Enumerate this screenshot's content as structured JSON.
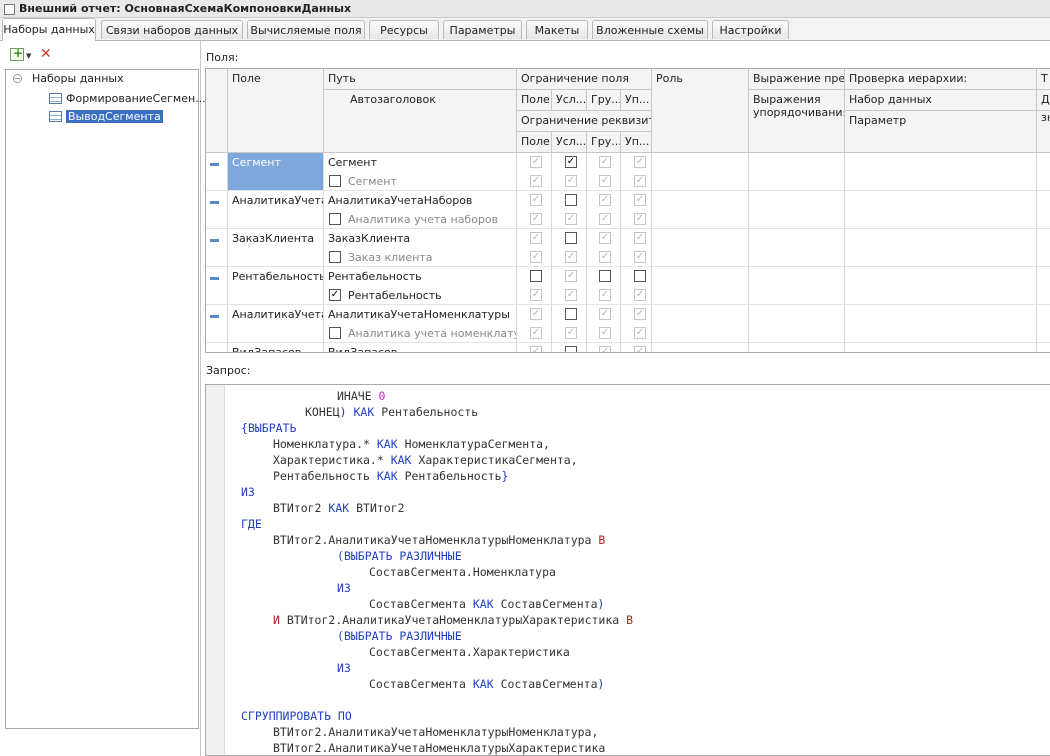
{
  "window": {
    "title": "Внешний отчет: ОсновнаяСхемаКомпоновкиДанных"
  },
  "tabs": [
    "Наборы данных",
    "Связи наборов данных",
    "Вычисляемые поля",
    "Ресурсы",
    "Параметры",
    "Макеты",
    "Вложенные схемы",
    "Настройки"
  ],
  "sidebar": {
    "root": "Наборы данных",
    "items": [
      "ФормированиеСегмен...",
      "ВыводСегмента"
    ]
  },
  "fields": {
    "label": "Поля:",
    "headers": {
      "field": "Поле",
      "path": "Путь",
      "autotitle": "Автозаголовок",
      "field_restriction": "Ограничение поля",
      "attr_restriction": "Ограничение реквизитов",
      "sub": [
        "Поле",
        "Усл...",
        "Гру...",
        "Уп..."
      ],
      "role": "Роль",
      "expression": "Выражение пре...",
      "order_expr": "Выражения упорядочивания",
      "hierarchy": "Проверка иерархии:",
      "dataset": "Набор данных",
      "parameter": "Параметр",
      "last_a": "Т",
      "last_b": "Д",
      "last_c": "зн"
    },
    "rows": [
      {
        "field": "Сегмент",
        "path": "Сегмент",
        "title": "Сегмент",
        "title_checked": false
      },
      {
        "field": "АналитикаУчета",
        "path": "АналитикаУчетаНаборов",
        "title": "Аналитика учета наборов",
        "title_checked": false
      },
      {
        "field": "ЗаказКлиента",
        "path": "ЗаказКлиента",
        "title": "Заказ клиента",
        "title_checked": false
      },
      {
        "field": "Рентабельность",
        "path": "Рентабельность",
        "title": "Рентабельность",
        "title_checked": true
      },
      {
        "field": "АналитикаУчета",
        "path": "АналитикаУчетаНоменклатуры",
        "title": "Аналитика учета номенклатур...",
        "title_checked": false
      },
      {
        "field": "ВидЗапасов",
        "path": "ВидЗапасов",
        "title": "",
        "title_checked": false
      }
    ]
  },
  "query": {
    "label": "Запрос:",
    "lines": [
      "ИНАЧЕ 0",
      "КОНЕЦ) КАК Рентабельность",
      "{ВЫБРАТЬ",
      "Номенклатура.* КАК НоменклатураСегмента,",
      "Характеристика.* КАК ХарактеристикаСегмента,",
      "Рентабельность КАК Рентабельность}",
      "ИЗ",
      "ВТИтог2 КАК ВТИтог2",
      "ГДЕ",
      "ВТИтог2.АналитикаУчетаНоменклатурыНоменклатура В",
      "(ВЫБРАТЬ РАЗЛИЧНЫЕ",
      "СоставСегмента.Номенклатура",
      "ИЗ",
      "СоставСегмента КАК СоставСегмента)",
      "И ВТИтог2.АналитикаУчетаНоменклатурыХарактеристика В",
      "(ВЫБРАТЬ РАЗЛИЧНЫЕ",
      "СоставСегмента.Характеристика",
      "ИЗ",
      "СоставСегмента КАК СоставСегмента)",
      "",
      "СГРУППИРОВАТЬ ПО",
      "ВТИтог2.АналитикаУчетаНоменклатурыНоменклатура,",
      "ВТИтог2.АналитикаУчетаНоменклатурыХарактеристика"
    ]
  }
}
